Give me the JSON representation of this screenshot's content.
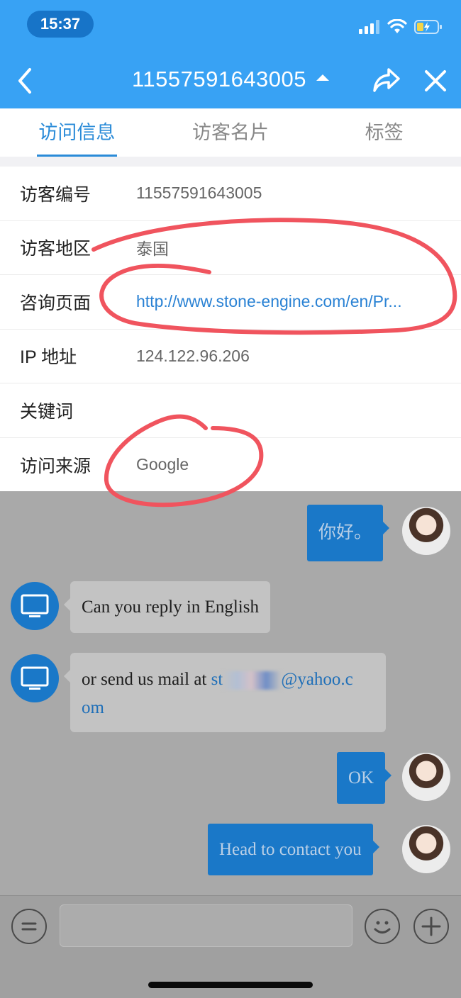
{
  "status_bar": {
    "time": "15:37"
  },
  "header": {
    "title": "11557591643005"
  },
  "tabs": [
    {
      "label": "访问信息",
      "active": true
    },
    {
      "label": "访客名片",
      "active": false
    },
    {
      "label": "标签",
      "active": false
    }
  ],
  "info_rows": [
    {
      "label": "访客编号",
      "value": "11557591643005"
    },
    {
      "label": "访客地区",
      "value": "泰国"
    },
    {
      "label": "咨询页面",
      "value": "http://www.stone-engine.com/en/Pr..."
    },
    {
      "label": "IP 地址",
      "value": "124.122.96.206"
    },
    {
      "label": "关键词",
      "value": ""
    },
    {
      "label": "访问来源",
      "value": "Google"
    }
  ],
  "chat": {
    "messages": [
      {
        "from": "agent",
        "text": "你好。"
      },
      {
        "from": "visitor",
        "text": "Can you reply in English"
      },
      {
        "from": "visitor",
        "prefix": "or send us mail at ",
        "line1": "st",
        "line1_end": "@yahoo.c",
        "line2": "om"
      },
      {
        "from": "agent",
        "text": "OK"
      },
      {
        "from": "agent",
        "text": "Head to contact you"
      }
    ]
  },
  "colors": {
    "header_bg": "#38a2f4",
    "accent": "#2a8bd8",
    "annotation": "#f0545e",
    "chat_bg": "#a9a9a9",
    "agent_bubble": "#1a78c8"
  },
  "icons": {
    "back": "chevron-left-icon",
    "title_toggle": "caret-up-icon",
    "share": "share-arrow-icon",
    "close": "close-icon",
    "menu": "menu-icon",
    "emoji": "smiley-icon",
    "add": "plus-icon",
    "visitor_avatar": "monitor-icon"
  }
}
